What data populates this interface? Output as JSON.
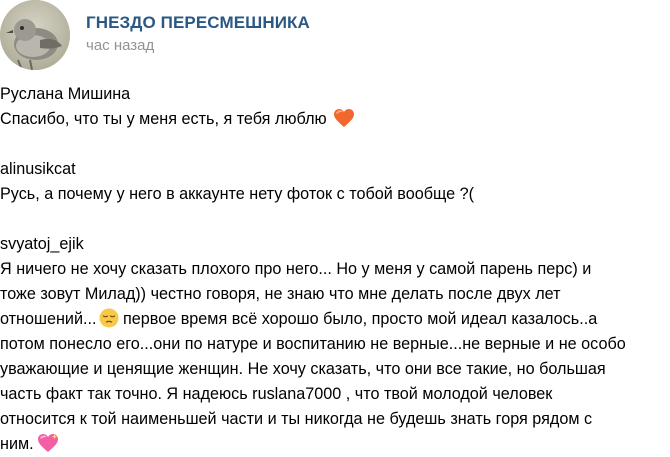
{
  "header": {
    "group_name": "ГНЕЗДО ПЕРЕСМЕШНИКА",
    "time": "час назад",
    "avatar_icon": "bird-avatar"
  },
  "comments": [
    {
      "author": "Руслана Мишина",
      "lines": [
        "Спасибо, что ты у меня есть, я тебя люблю"
      ],
      "emoji": "orange-heart-icon"
    },
    {
      "author": "alinusikcat",
      "lines": [
        "Русь, а почему у него в аккаунте нету фоток с тобой вообще ?("
      ]
    },
    {
      "author": "svyatoj_ejik",
      "lines": [
        "Я ничего не хочу сказать плохого про него... Но у меня у самой парень перс) и",
        "тоже зовут Милад)) честно говоря, не знаю что мне делать после двух лет",
        "отношений...",
        " первое время всё хорошо было, просто мой идеал казалось..а",
        "потом понесло его...они по натуре и воспитанию не верные...не верные и не особо",
        "уважающие и ценящие женщин. Не хочу сказать, что они все такие, но большая",
        "часть факт так точно. Я надеюсь ruslana7000 , что твой молодой человек",
        "относится к той наименьшей части и ты никогда не будешь знать горя рядом с",
        "ним."
      ],
      "emoji_pensive": "pensive-face-icon",
      "emoji_end": "sparkling-heart-icon"
    }
  ]
}
